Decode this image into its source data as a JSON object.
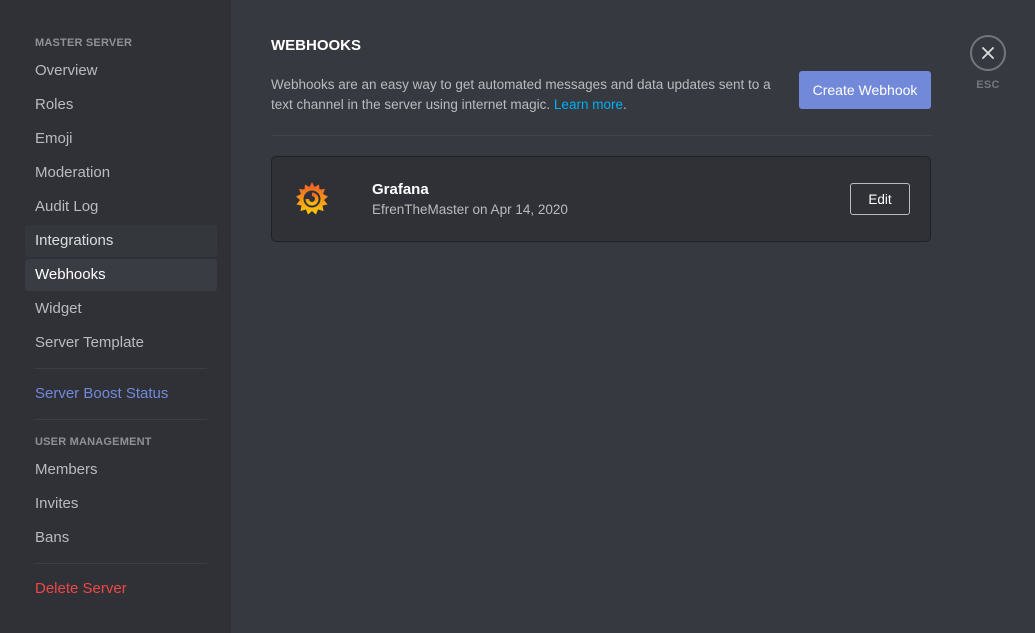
{
  "sidebar": {
    "server_section": "MASTER SERVER",
    "items": [
      {
        "label": "Overview"
      },
      {
        "label": "Roles"
      },
      {
        "label": "Emoji"
      },
      {
        "label": "Moderation"
      },
      {
        "label": "Audit Log"
      },
      {
        "label": "Integrations"
      },
      {
        "label": "Webhooks"
      },
      {
        "label": "Widget"
      },
      {
        "label": "Server Template"
      }
    ],
    "boost_label": "Server Boost Status",
    "user_section": "USER MANAGEMENT",
    "user_items": [
      {
        "label": "Members"
      },
      {
        "label": "Invites"
      },
      {
        "label": "Bans"
      }
    ],
    "delete_label": "Delete Server"
  },
  "main": {
    "title": "WEBHOOKS",
    "description": "Webhooks are an easy way to get automated messages and data updates sent to a text channel in the server using internet magic.",
    "learn_more": "Learn more",
    "create_button": "Create Webhook",
    "webhooks": [
      {
        "name": "Grafana",
        "meta": "EfrenTheMaster on Apr 14, 2020",
        "edit_label": "Edit",
        "icon": "grafana-logo-icon"
      }
    ]
  },
  "close": {
    "esc_label": "ESC"
  },
  "colors": {
    "accent": "#7289da",
    "danger": "#f04747",
    "link": "#00b0f4",
    "sidebar_bg": "#2f3136",
    "content_bg": "#36393f"
  }
}
